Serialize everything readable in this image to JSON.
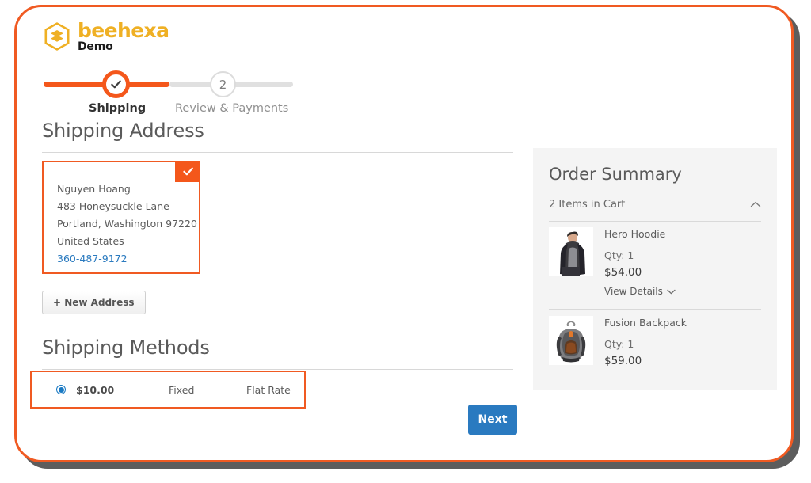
{
  "brand": {
    "word": "beehexa",
    "sub": "Demo",
    "logo_color": "#efb024",
    "accent_orange": "#f4571b",
    "link_blue": "#2a7abf",
    "button_blue": "#2a7ac0"
  },
  "steps": {
    "step1": {
      "label": "Shipping",
      "state": "complete",
      "icon": "check-icon"
    },
    "step2": {
      "label": "Review & Payments",
      "number": "2",
      "state": "upcoming"
    }
  },
  "shipping_address": {
    "title": "Shipping Address",
    "selected_badge_icon": "check-icon",
    "card": {
      "name": "Nguyen Hoang",
      "street": "483 Honeysuckle Lane",
      "city_state_zip": "Portland, Washington 97220",
      "country": "United States",
      "phone": "360-487-9172"
    },
    "new_address_label": "+ New Address"
  },
  "shipping_methods": {
    "title": "Shipping Methods",
    "rows": [
      {
        "selected": true,
        "price": "$10.00",
        "carrier": "Fixed",
        "method": "Flat Rate"
      }
    ]
  },
  "actions": {
    "next_label": "Next"
  },
  "order_summary": {
    "title": "Order Summary",
    "items_in_cart_label": "2 Items in Cart",
    "collapse_icon": "chevron-up-icon",
    "items": [
      {
        "name": "Hero Hoodie",
        "qty_label": "Qty: 1",
        "price": "$54.00",
        "details_label": "View Details",
        "details_icon": "chevron-down-icon",
        "thumb": "hero-hoodie-photo"
      },
      {
        "name": "Fusion Backpack",
        "qty_label": "Qty: 1",
        "price": "$59.00",
        "thumb": "fusion-backpack-photo"
      }
    ]
  }
}
